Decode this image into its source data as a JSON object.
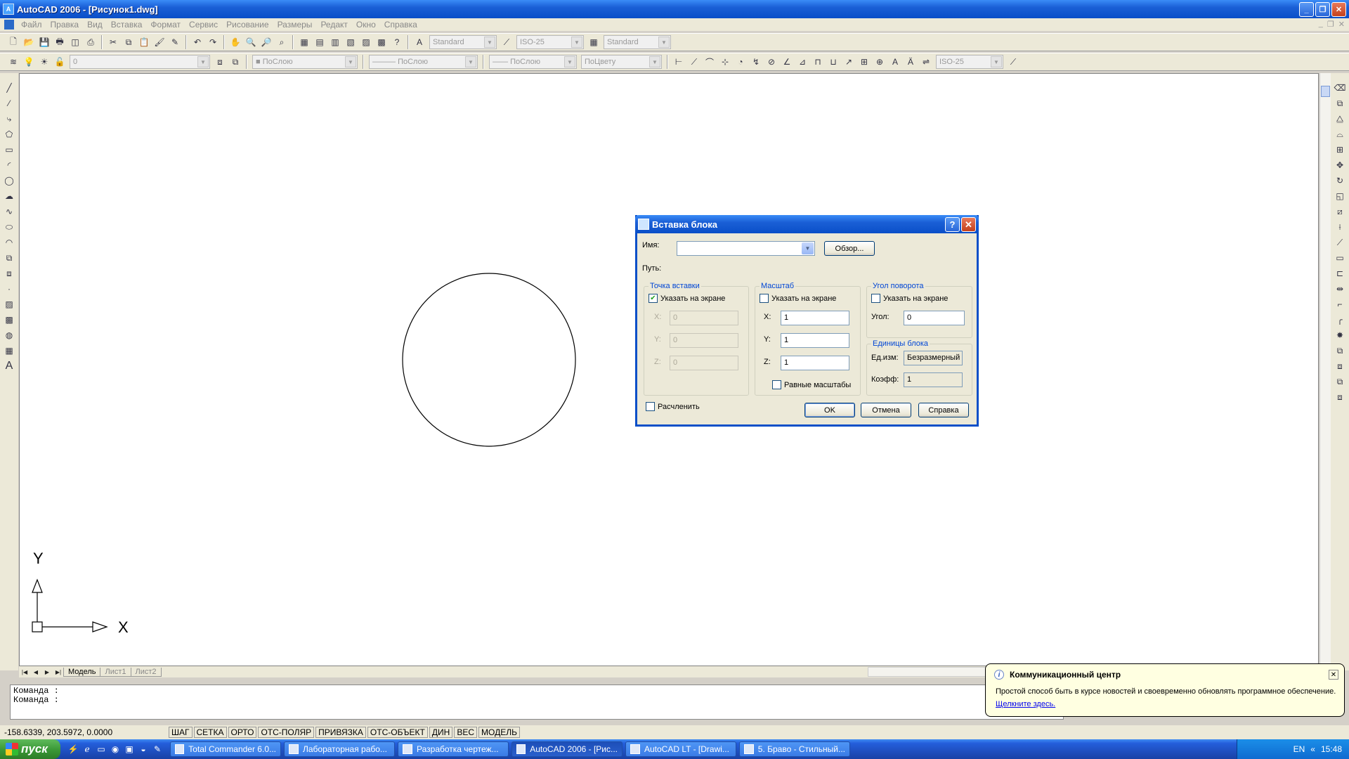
{
  "window": {
    "title": "AutoCAD 2006 - [Рисунок1.dwg]",
    "app_icon": "autocad-icon"
  },
  "menu": [
    "Файл",
    "Правка",
    "Вид",
    "Вставка",
    "Формат",
    "Сервис",
    "Рисование",
    "Размеры",
    "Редакт",
    "Окно",
    "Справка"
  ],
  "toolbar1": {
    "text_style": "Standard",
    "dim_style": "ISO-25",
    "table_style": "Standard"
  },
  "toolbar2": {
    "layer": "0",
    "color": "ПоСлою",
    "linetype": "ПоСлою",
    "lineweight": "ПоСлою",
    "plotstyle": "ПоЦвету",
    "dim_style": "ISO-25"
  },
  "ucs": {
    "x_label": "X",
    "y_label": "Y"
  },
  "layout_tabs": [
    "Модель",
    "Лист1",
    "Лист2"
  ],
  "command_lines": [
    "Команда :",
    "Команда :"
  ],
  "status": {
    "coords": "-158.6339, 203.5972, 0.0000",
    "buttons": [
      "ШАГ",
      "СЕТКА",
      "ОРТО",
      "ОТС-ПОЛЯР",
      "ПРИВЯЗКА",
      "ОТС-ОБЪЕКТ",
      "ДИН",
      "ВЕС",
      "МОДЕЛЬ"
    ]
  },
  "taskbar": {
    "start": "пуск",
    "tasks": [
      "Total Commander 6.0...",
      "Лабораторная рабо...",
      "Разработка чертеж...",
      "AutoCAD 2006 - [Рис...",
      "AutoCAD LT - [Drawi...",
      "5. Браво - Стильный..."
    ],
    "lang": "EN",
    "time": "15:48"
  },
  "dialog": {
    "title": "Вставка блока",
    "name_label": "Имя:",
    "name_value": "",
    "browse_label": "Обзор...",
    "path_label": "Путь:",
    "insert_point": {
      "title": "Точка вставки",
      "on_screen_label": "Указать на экране",
      "on_screen_checked": true,
      "x_label": "X:",
      "x_value": "0",
      "y_label": "Y:",
      "y_value": "0",
      "z_label": "Z:",
      "z_value": "0"
    },
    "scale": {
      "title": "Масштаб",
      "on_screen_label": "Указать на экране",
      "on_screen_checked": false,
      "x_label": "X:",
      "x_value": "1",
      "y_label": "Y:",
      "y_value": "1",
      "z_label": "Z:",
      "z_value": "1",
      "uniform_label": "Равные масштабы",
      "uniform_checked": false
    },
    "rotation": {
      "title": "Угол поворота",
      "on_screen_label": "Указать на экране",
      "on_screen_checked": false,
      "angle_label": "Угол:",
      "angle_value": "0"
    },
    "block_units": {
      "title": "Единицы блока",
      "unit_label": "Ед.изм:",
      "unit_value": "Безразмерный",
      "factor_label": "Коэфф:",
      "factor_value": "1"
    },
    "explode_label": "Расчленить",
    "explode_checked": false,
    "ok_label": "OK",
    "cancel_label": "Отмена",
    "help_label": "Справка"
  },
  "balloon": {
    "title": "Коммуникационный центр",
    "text": "Простой способ быть в курсе новостей и своевременно обновлять программное обеспечение.",
    "link": "Щелкните здесь."
  }
}
